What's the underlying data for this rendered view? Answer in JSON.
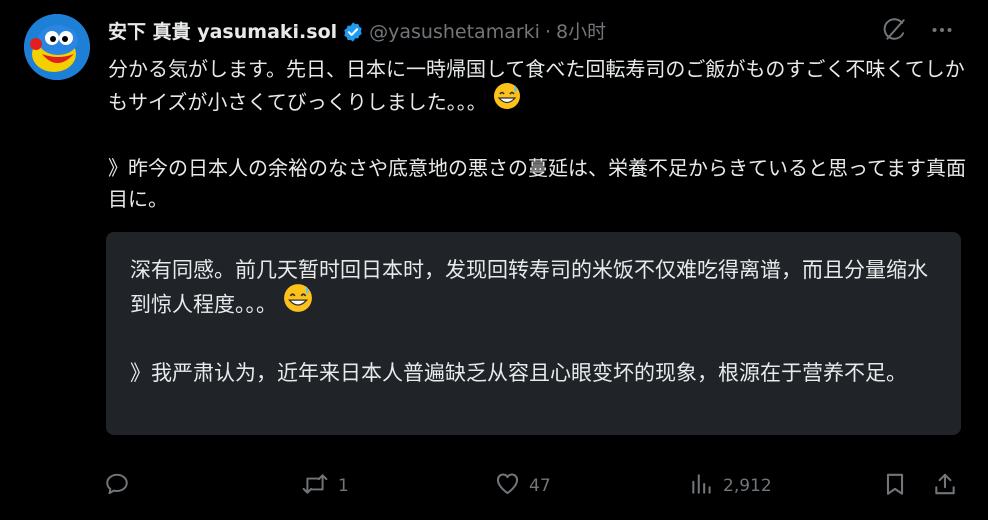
{
  "author": {
    "display_name": "安下 真貴 yasumaki.sol",
    "handle": "@yasushetamarki",
    "separator": "·",
    "time": "8小时"
  },
  "tweet": {
    "paragraph1": "分かる気がします。先日、日本に一時帰国して食べた回転寿司のご飯がものすごく不味くてしかもサイズが小さくてびっくりしました。。。",
    "paragraph2": "》昨今の日本人の余裕のなさや底意地の悪さの蔓延は、栄養不足からきていると思ってます真面目に。"
  },
  "translation": {
    "paragraph1": "深有同感。前几天暂时回日本时，发现回转寿司的米饭不仅难吃得离谱，而且分量缩水到惊人程度。。。",
    "paragraph2": "》我严肃认为，近年来日本人普遍缺乏从容且心眼变坏的现象，根源在于营养不足。"
  },
  "actions": {
    "reply_count": "",
    "retweet_count": "1",
    "like_count": "47",
    "views_count": "2,912"
  },
  "colors": {
    "background": "#000000",
    "text": "#e7e9ea",
    "muted": "#71767b",
    "verified": "#1d9bf0",
    "translation_bg": "#202327"
  },
  "icons": [
    "avatar",
    "verified-badge-icon",
    "grok-icon",
    "more-icon",
    "grinning-sweat-emoji",
    "reply-icon",
    "retweet-icon",
    "like-icon",
    "views-icon",
    "bookmark-icon",
    "share-icon"
  ]
}
